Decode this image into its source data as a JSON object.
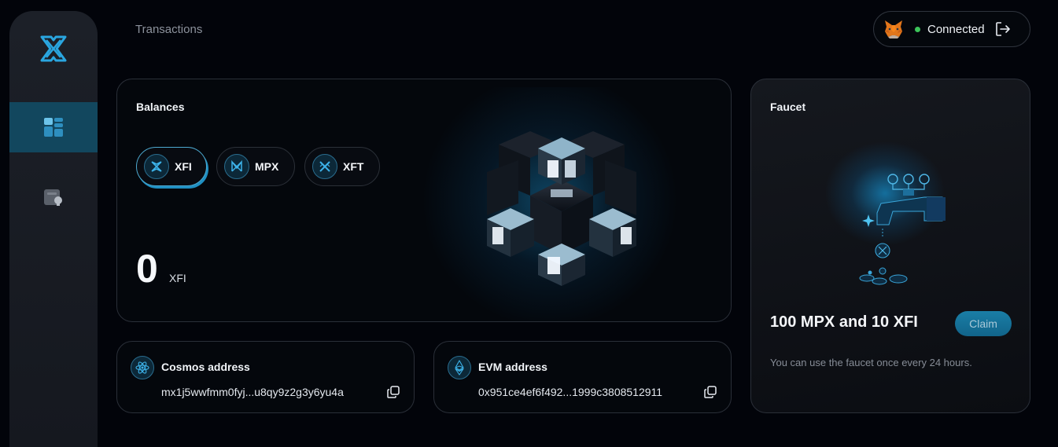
{
  "header": {
    "title": "Transactions",
    "wallet_status": "Connected",
    "status_color": "#3cc45a"
  },
  "sidebar": {
    "items": [
      {
        "name": "dashboard",
        "icon": "dashboard-icon",
        "active": true
      },
      {
        "name": "wallet",
        "icon": "wallet-icon",
        "active": false
      }
    ]
  },
  "balances": {
    "title": "Balances",
    "tokens": [
      {
        "label": "XFI",
        "selected": true
      },
      {
        "label": "MPX",
        "selected": false
      },
      {
        "label": "XFT",
        "selected": false
      }
    ],
    "amount": "0",
    "unit": "XFI"
  },
  "addresses": {
    "cosmos": {
      "title": "Cosmos address",
      "value": "mx1j5wwfmm0fyj...u8qy9z2g3y6yu4a"
    },
    "evm": {
      "title": "EVM address",
      "value": "0x951ce4ef6f492...1999c3808512911"
    }
  },
  "faucet": {
    "title": "Faucet",
    "amount": "100 MPX and 10 XFI",
    "claim_label": "Claim",
    "note": "You can use the faucet once every 24 hours."
  },
  "colors": {
    "accent": "#1f8fc2",
    "active_nav": "#12475e",
    "background": "#02040a"
  }
}
